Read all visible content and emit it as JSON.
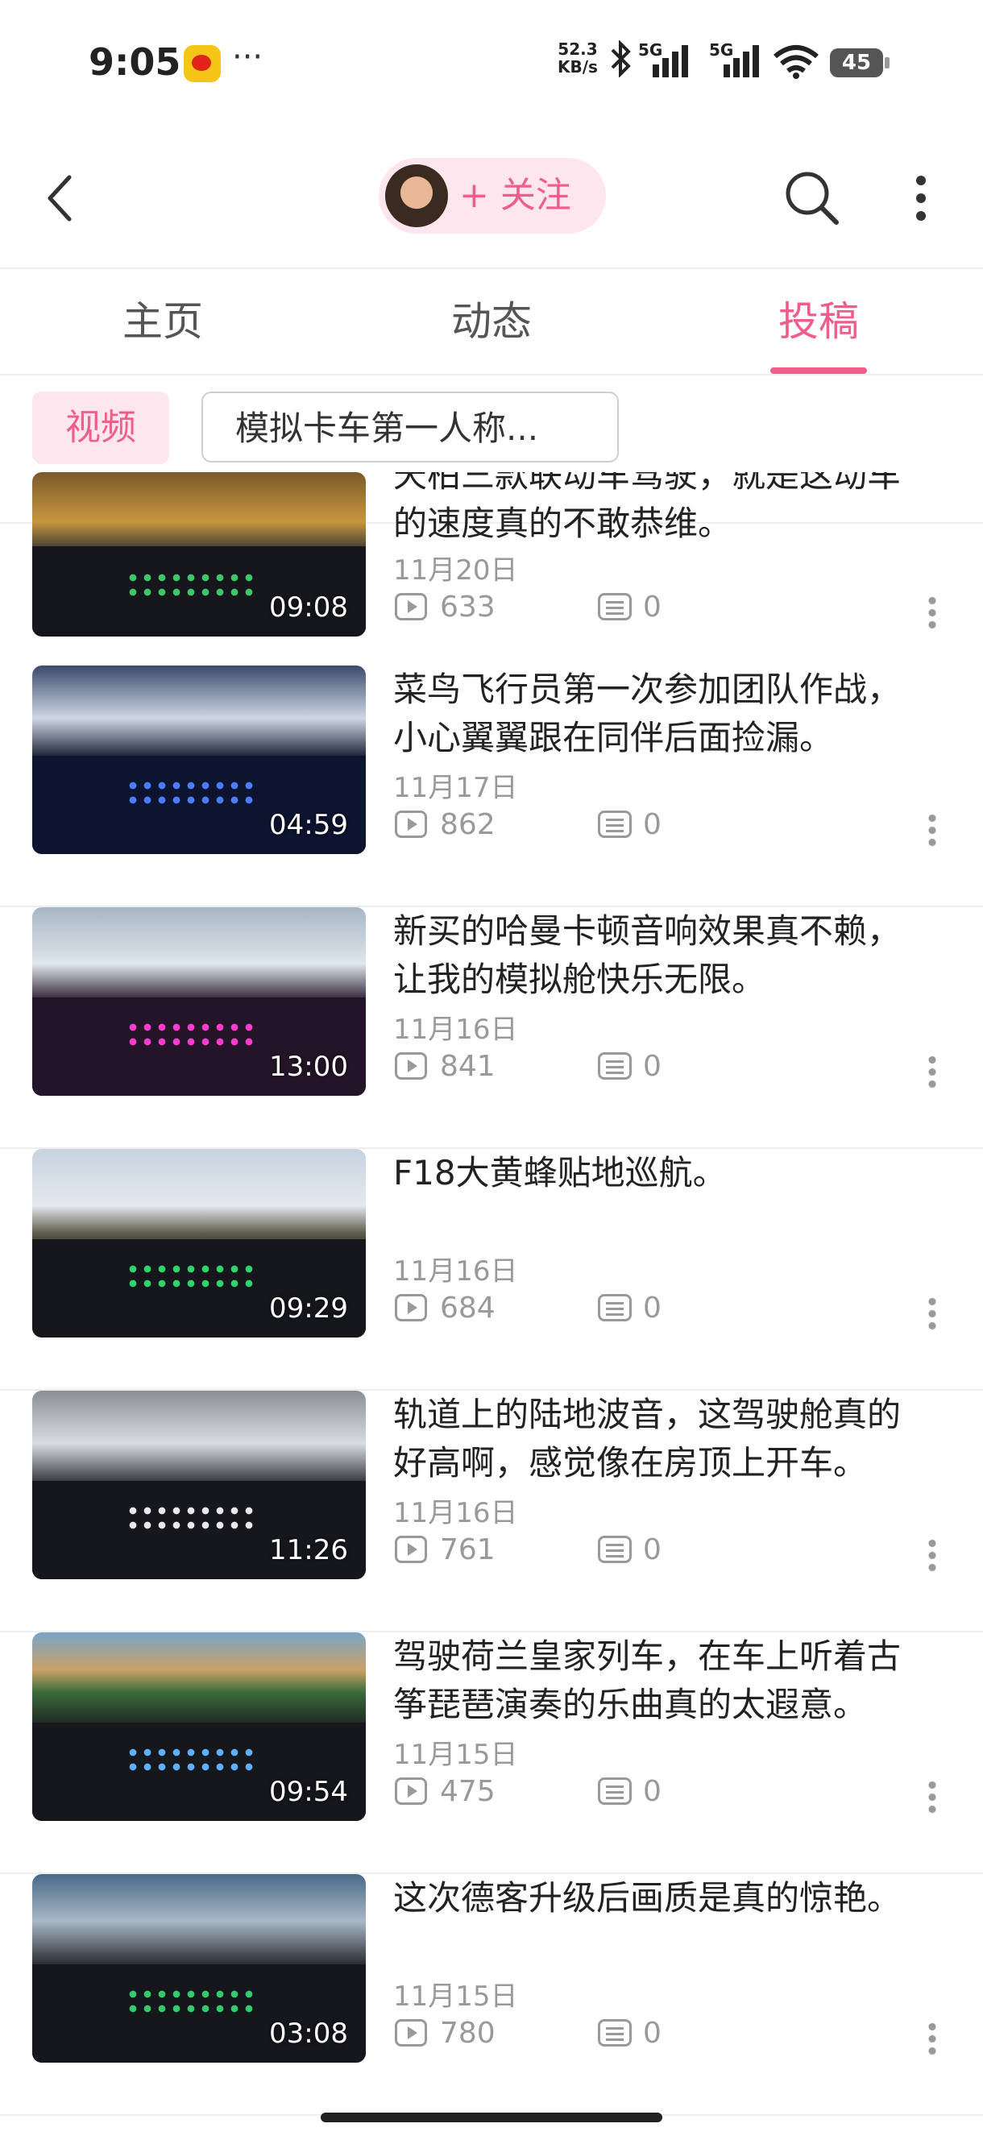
{
  "status_bar": {
    "time": "9:05",
    "dots": "···",
    "net_speed_value": "52.3",
    "net_speed_unit": "KB/s",
    "signal1_label": "5G",
    "signal2_label": "5G",
    "battery": "45"
  },
  "header": {
    "follow_label": "+ 关注"
  },
  "tabs": [
    {
      "label": "主页"
    },
    {
      "label": "动态"
    },
    {
      "label": "投稿"
    }
  ],
  "filters": {
    "video_chip": "视频",
    "collection_chip": "模拟卡车第一人称..."
  },
  "videos": [
    {
      "title_line1": "天柏三款联动车驾驶，就是这动车",
      "title_line2": "的速度真的不敢恭维。",
      "date": "11月20日",
      "plays": "633",
      "comments": "0",
      "duration": "09:08"
    },
    {
      "title_line1": "菜鸟飞行员第一次参加团队作战，",
      "title_line2": "小心翼翼跟在同伴后面捡漏。",
      "date": "11月17日",
      "plays": "862",
      "comments": "0",
      "duration": "04:59"
    },
    {
      "title_line1": "新买的哈曼卡顿音响效果真不赖，",
      "title_line2": "让我的模拟舱快乐无限。",
      "date": "11月16日",
      "plays": "841",
      "comments": "0",
      "duration": "13:00"
    },
    {
      "title_line1": "F18大黄蜂贴地巡航。",
      "title_line2": "",
      "date": "11月16日",
      "plays": "684",
      "comments": "0",
      "duration": "09:29"
    },
    {
      "title_line1": "轨道上的陆地波音，这驾驶舱真的",
      "title_line2": "好高啊，感觉像在房顶上开车。",
      "date": "11月16日",
      "plays": "761",
      "comments": "0",
      "duration": "11:26"
    },
    {
      "title_line1": "驾驶荷兰皇家列车，在车上听着古",
      "title_line2": "筝琵琶演奏的乐曲真的太遐意。",
      "date": "11月15日",
      "plays": "475",
      "comments": "0",
      "duration": "09:54"
    },
    {
      "title_line1": "这次德客升级后画质是真的惊艳。",
      "title_line2": "",
      "date": "11月15日",
      "plays": "780",
      "comments": "0",
      "duration": "03:08"
    }
  ],
  "colors": {
    "accent": "#ef5e8a",
    "accent_bg": "#fde6ee",
    "muted": "#999999"
  },
  "icons": [
    "back-arrow-icon",
    "search-icon",
    "more-vertical-icon",
    "play-count-icon",
    "comment-count-icon",
    "item-menu-icon"
  ]
}
